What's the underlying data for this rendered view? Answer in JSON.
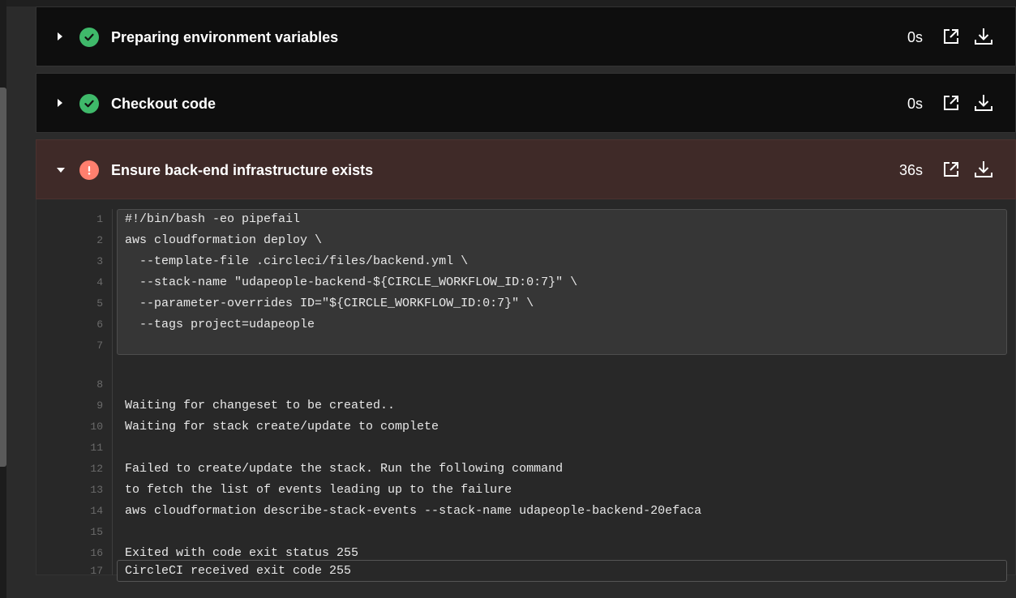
{
  "steps": [
    {
      "title": "Preparing environment variables",
      "duration": "0s",
      "status": "success"
    },
    {
      "title": "Checkout code",
      "duration": "0s",
      "status": "success"
    },
    {
      "title": "Ensure back-end infrastructure exists",
      "duration": "36s",
      "status": "failed"
    }
  ],
  "output_lines": [
    {
      "n": "1",
      "text": "#!/bin/bash -eo pipefail"
    },
    {
      "n": "2",
      "text": "aws cloudformation deploy \\"
    },
    {
      "n": "3",
      "text": "  --template-file .circleci/files/backend.yml \\"
    },
    {
      "n": "4",
      "text": "  --stack-name \"udapeople-backend-${CIRCLE_WORKFLOW_ID:0:7}\" \\"
    },
    {
      "n": "5",
      "text": "  --parameter-overrides ID=\"${CIRCLE_WORKFLOW_ID:0:7}\" \\"
    },
    {
      "n": "6",
      "text": "  --tags project=udapeople"
    },
    {
      "n": "7",
      "text": ""
    },
    {
      "n": "8",
      "text": ""
    },
    {
      "n": "9",
      "text": "Waiting for changeset to be created.."
    },
    {
      "n": "10",
      "text": "Waiting for stack create/update to complete"
    },
    {
      "n": "11",
      "text": ""
    },
    {
      "n": "12",
      "text": "Failed to create/update the stack. Run the following command"
    },
    {
      "n": "13",
      "text": "to fetch the list of events leading up to the failure"
    },
    {
      "n": "14",
      "text": "aws cloudformation describe-stack-events --stack-name udapeople-backend-20efaca"
    },
    {
      "n": "15",
      "text": ""
    },
    {
      "n": "16",
      "text": "Exited with code exit status 255"
    },
    {
      "n": "17",
      "text": "CircleCI received exit code 255"
    }
  ],
  "colors": {
    "success": "#3fb96a",
    "error": "#ff7f6e",
    "failed_header_bg": "#3f2a28"
  },
  "icons": {
    "expand": "chevron-right-icon",
    "collapse": "chevron-down-icon",
    "success": "check-circle-icon",
    "error": "exclamation-circle-icon",
    "open": "open-in-new-icon",
    "download": "download-icon"
  }
}
